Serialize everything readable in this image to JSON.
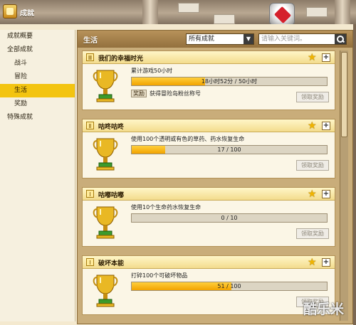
{
  "window": {
    "title": "成就"
  },
  "sidebar": {
    "items": [
      {
        "label": "成就概要"
      },
      {
        "label": "全部成就"
      },
      {
        "label": "战斗"
      },
      {
        "label": "冒险"
      },
      {
        "label": "生活"
      },
      {
        "label": "奖励"
      },
      {
        "label": "特殊成就"
      }
    ]
  },
  "panel": {
    "title": "生活",
    "filter_value": "所有成就",
    "search_placeholder": "请输入关键词。"
  },
  "achievements": [
    {
      "title": "我们的幸福时光",
      "flag": "Ⅲ",
      "desc": "累计游戏50小时",
      "progress_text": "18小时52分 / 50小时",
      "progress": 0.377,
      "reward_tag": "奖励",
      "reward": "获得冒险岛粉丝称号",
      "claim": "领取奖励"
    },
    {
      "title": "咕咚咕咚",
      "flag": "Ⅱ",
      "desc": "使用100个透明或有色的草药、药水恢复生命",
      "progress_text": "17 / 100",
      "progress": 0.17,
      "claim": "领取奖励"
    },
    {
      "title": "咕嘟咕嘟",
      "flag": "Ⅰ",
      "desc": "使用10个生命药水恢复生命",
      "progress_text": "0 / 10",
      "progress": 0,
      "claim": "领取奖励"
    },
    {
      "title": "破坏本能",
      "flag": "Ⅰ",
      "desc": "打碎100个可破坏物品",
      "progress_text": "51 / 100",
      "progress": 0.51,
      "claim": "领取奖励"
    }
  ],
  "watermark": "酷乐米",
  "colors": {
    "accent": "#f3c410",
    "bar_fill": "#f2a300",
    "header": "#93703d"
  },
  "icons": [
    "title-icon",
    "star-icon",
    "plus-icon",
    "trophy-icon",
    "dropdown-arrow-icon",
    "search-icon"
  ]
}
